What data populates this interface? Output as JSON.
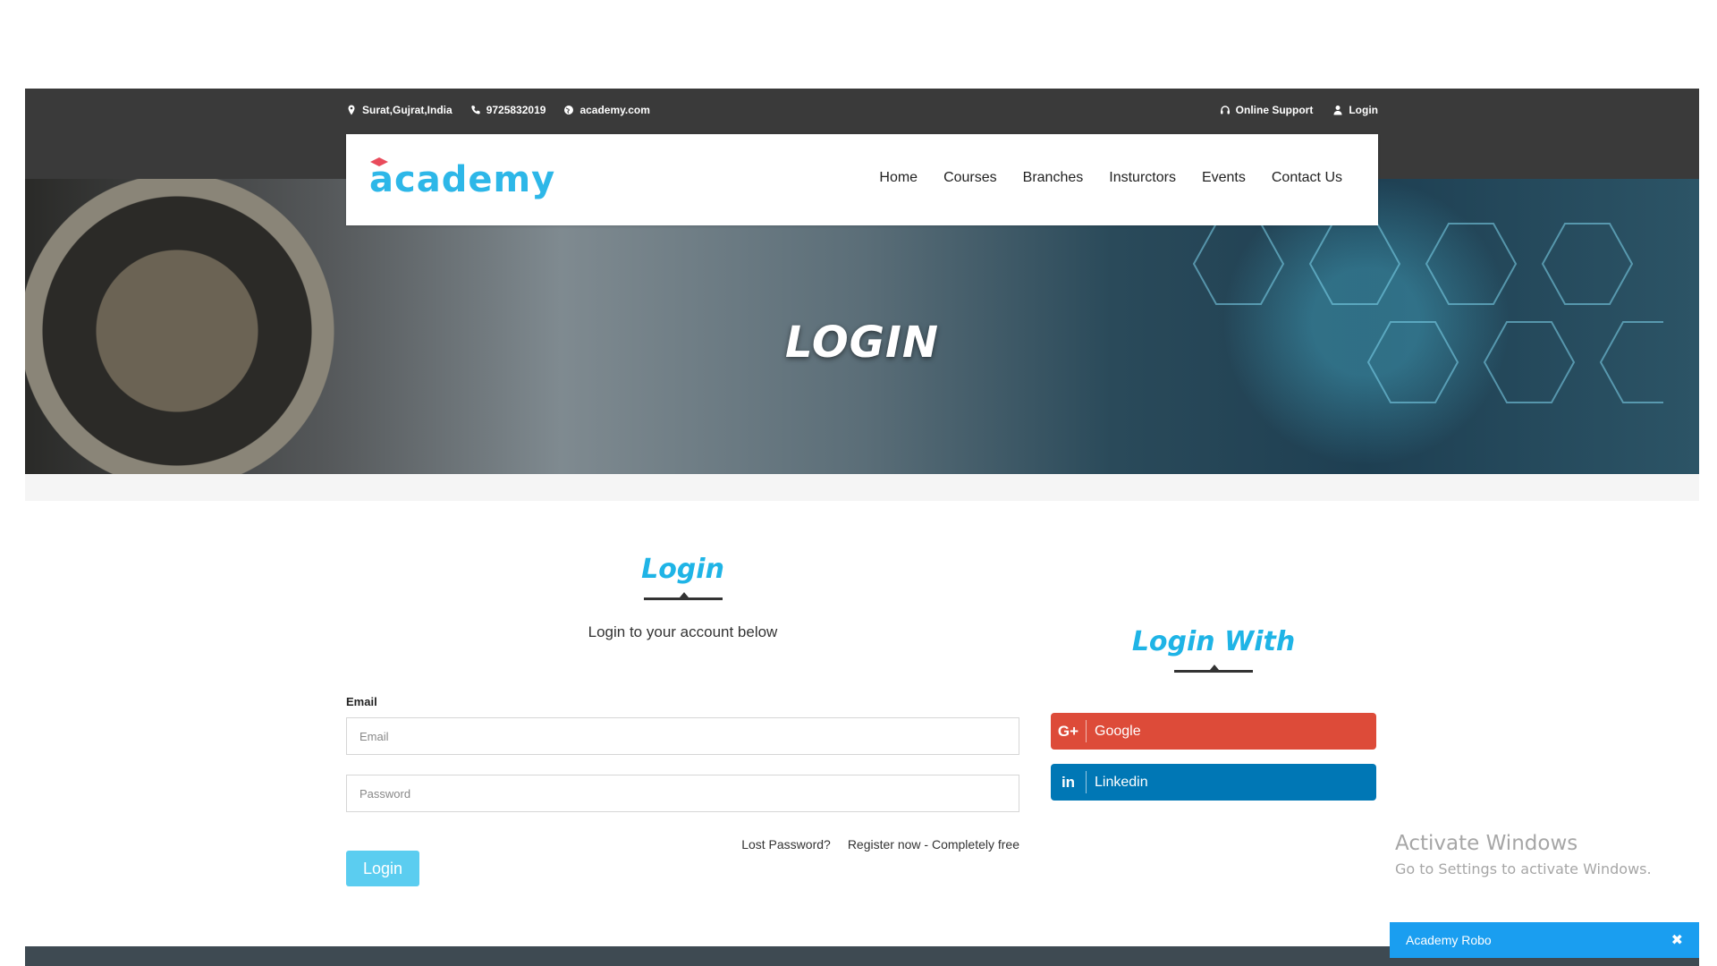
{
  "topbar": {
    "location": "Surat,Gujrat,India",
    "phone": "9725832019",
    "website": "academy.com",
    "online_support": "Online Support",
    "login": "Login"
  },
  "header": {
    "logo_text": "academy",
    "nav": [
      "Home",
      "Courses",
      "Branches",
      "Insturctors",
      "Events",
      "Contact Us"
    ]
  },
  "banner": {
    "title": "LOGIN"
  },
  "login_form": {
    "title": "Login",
    "subtitle": "Login to your account below",
    "email_label": "Email",
    "email_placeholder": "Email",
    "password_placeholder": "Password",
    "lost_password": "Lost Password?",
    "register": "Register now - Completely free",
    "submit": "Login"
  },
  "social": {
    "title": "Login With",
    "google": "Google",
    "google_icon": "G+",
    "linkedin": "Linkedin",
    "linkedin_icon": "in"
  },
  "watermark": {
    "line1": "Activate Windows",
    "line2": "Go to Settings to activate Windows."
  },
  "chat": {
    "label": "Academy Robo",
    "close": "✖"
  },
  "colors": {
    "accent": "#1fb4e6",
    "google": "#dd4b39",
    "linkedin": "#0077b5",
    "topbar": "#3a3a3a",
    "chat": "#1a9ef0"
  }
}
